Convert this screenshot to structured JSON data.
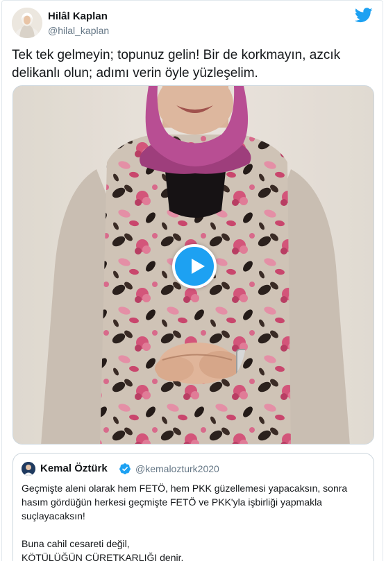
{
  "tweet": {
    "author_name": "Hilâl Kaplan",
    "author_handle": "@hilal_kaplan",
    "text": "Tek tek gelmeyin; topunuz gelin! Bir de korkmayın, azcık delikanlı olun; adımı verin öyle yüzleşelim."
  },
  "icons": {
    "brand": "twitter-bird-icon",
    "play": "play-icon",
    "verified": "verified-badge-icon"
  },
  "colors": {
    "brand_blue": "#1da1f2",
    "text_primary": "#14171a",
    "text_secondary": "#657786",
    "border": "#ccd6dd"
  },
  "quoted_tweet": {
    "author_name": "Kemal Öztürk",
    "author_handle": "@kemalozturk2020",
    "line1": "Geçmişte aleni olarak hem FETÖ, hem PKK güzellemesi yapacaksın, sonra hasım gördüğün herkesi  geçmişte FETÖ ve PKK'yla işbirliği yapmakla suçlayacaksın!",
    "line2": "Buna cahil cesareti değil,",
    "line3": "KÖTÜLÜĞÜN CÜRETKARLIĞI denir."
  }
}
